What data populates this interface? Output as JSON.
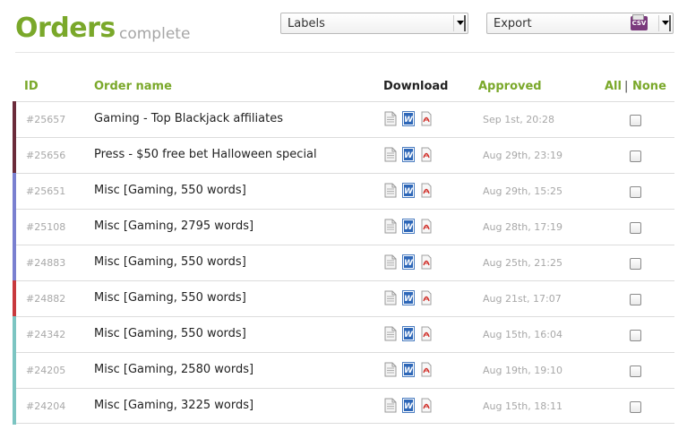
{
  "header": {
    "title": "Orders",
    "subtitle": "complete",
    "labels_dropdown": "Labels",
    "export_dropdown": "Export",
    "export_icon_text": "CSV"
  },
  "columns": {
    "id": "ID",
    "name": "Order name",
    "download": "Download",
    "approved": "Approved",
    "all": "All",
    "separator": "|",
    "none": "None"
  },
  "orders": [
    {
      "id": "#25657",
      "name": "Gaming - Top Blackjack affiliates",
      "approved": "Sep 1st, 20:28",
      "color": "#6b2b3a"
    },
    {
      "id": "#25656",
      "name": "Press - $50 free bet Halloween special",
      "approved": "Aug 29th, 23:19",
      "color": "#6b2b3a"
    },
    {
      "id": "#25651",
      "name": "Misc [Gaming, 550 words]",
      "approved": "Aug 29th, 15:25",
      "color": "#7a80d0"
    },
    {
      "id": "#25108",
      "name": "Misc [Gaming, 2795 words]",
      "approved": "Aug 28th, 17:19",
      "color": "#7a80d0"
    },
    {
      "id": "#24883",
      "name": "Misc [Gaming, 550 words]",
      "approved": "Aug 25th, 21:25",
      "color": "#7a80d0"
    },
    {
      "id": "#24882",
      "name": "Misc [Gaming, 550 words]",
      "approved": "Aug 21st, 17:07",
      "color": "#c8393d"
    },
    {
      "id": "#24342",
      "name": "Misc [Gaming, 550 words]",
      "approved": "Aug 15th, 16:04",
      "color": "#7cc5c2"
    },
    {
      "id": "#24205",
      "name": "Misc [Gaming, 2580 words]",
      "approved": "Aug 19th, 19:10",
      "color": "#7cc5c2"
    },
    {
      "id": "#24204",
      "name": "Misc [Gaming, 3225 words]",
      "approved": "Aug 15th, 18:11",
      "color": "#7cc5c2"
    }
  ],
  "colors": {
    "accent": "#7aa82a",
    "muted": "#a8a8a8"
  },
  "icons": [
    "text-file-icon",
    "word-doc-icon",
    "pdf-file-icon",
    "csv-icon",
    "chevron-down-icon"
  ]
}
